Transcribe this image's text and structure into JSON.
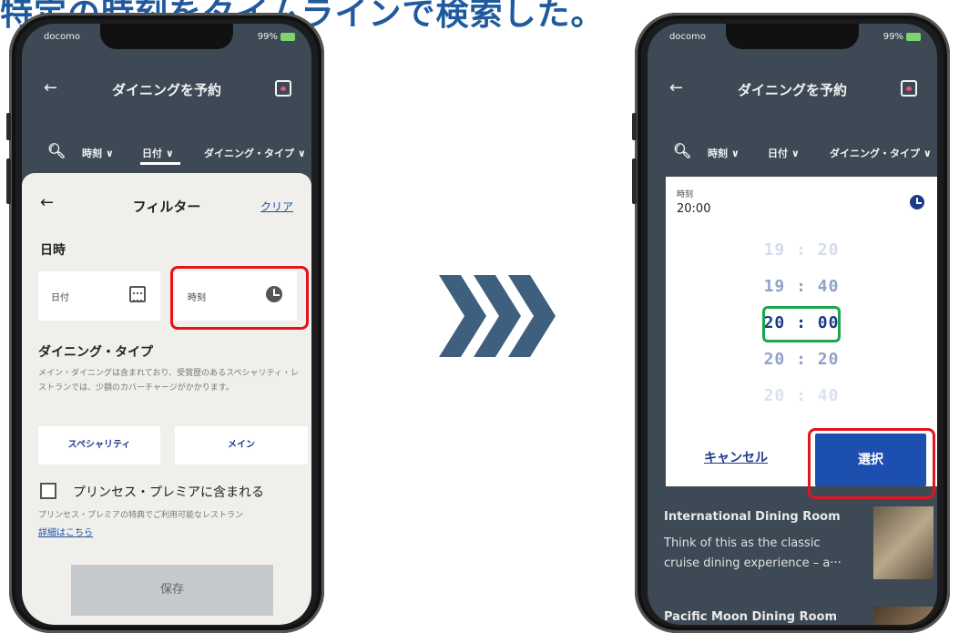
{
  "headline": "特定の時刻をタイムラインで検索した。",
  "arrow_icon": "triple-chevron-right-icon",
  "colors": {
    "accent": "#1d4fb0",
    "highlight_red": "#e1151b",
    "highlight_green": "#1aa64a"
  },
  "left_phone": {
    "status": {
      "carrier": "docomo",
      "battery": "99%"
    },
    "appbar": {
      "title": "ダイニングを予約"
    },
    "filters": [
      "時刻 ∨",
      "日付 ∨",
      "ダイニング・タイプ ∨"
    ],
    "panel": {
      "title": "フィルター",
      "clear": "クリア",
      "section_datetime": "日時",
      "date_label": "日付",
      "time_label": "時刻",
      "section_type": "ダイニング・タイプ",
      "description": "メイン・ダイニングは含まれており、受賞歴のあるスペシャリティ・レストランでは、少額のカバーチャージがかかります。",
      "option_specialty": "スペシャリティ",
      "option_main": "メイン",
      "checkbox_label": "プリンセス・プレミアに含まれる",
      "note": "プリンセス・プレミアの特典でご利用可能なレストラン",
      "more_link": "詳細はこちら",
      "save": "保存"
    }
  },
  "right_phone": {
    "status": {
      "carrier": "docomo",
      "battery": "99%"
    },
    "appbar": {
      "title": "ダイニングを予約"
    },
    "filters": [
      "時刻 ∨",
      "日付 ∨",
      "ダイニング・タイプ ∨"
    ],
    "dialog": {
      "label": "時刻",
      "value": "20:00",
      "times": [
        "19 : 20",
        "19 : 40",
        "20 : 00",
        "20 : 20",
        "20 : 40"
      ],
      "cancel": "キャンセル",
      "select": "選択"
    },
    "cards": [
      {
        "title": "International Dining Room",
        "description": "Think of this as the classic cruise dining experience – a···"
      },
      {
        "title": "Pacific Moon Dining Room"
      }
    ]
  }
}
